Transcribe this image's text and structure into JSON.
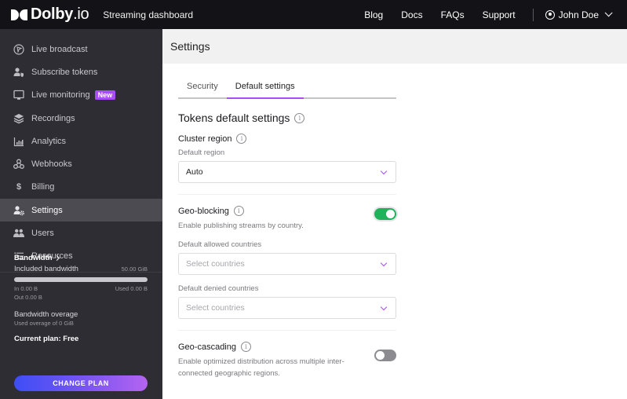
{
  "topbar": {
    "brand": "Dolby",
    "brand_suffix": ".io",
    "product": "Streaming dashboard",
    "links": [
      "Blog",
      "Docs",
      "FAQs",
      "Support"
    ],
    "user_name": "John Doe"
  },
  "sidebar": {
    "items": [
      {
        "label": "Live broadcast",
        "icon": "broadcast-icon"
      },
      {
        "label": "Subscribe tokens",
        "icon": "user-shield-icon"
      },
      {
        "label": "Live monitoring",
        "icon": "monitor-icon",
        "badge": "New"
      },
      {
        "label": "Recordings",
        "icon": "layers-icon"
      },
      {
        "label": "Analytics",
        "icon": "bar-chart-icon"
      },
      {
        "label": "Webhooks",
        "icon": "webhook-icon"
      },
      {
        "label": "Billing",
        "icon": "dollar-icon"
      },
      {
        "label": "Settings",
        "icon": "user-gear-icon",
        "active": true
      },
      {
        "label": "Users",
        "icon": "users-icon"
      },
      {
        "label": "Resources",
        "icon": "list-icon"
      }
    ],
    "bandwidth": {
      "title": "Bandwidth",
      "included_label": "Included bandwidth",
      "included_value": "50.00 GiB",
      "usage_fraction": 0,
      "in_label": "In 0.00 B",
      "used_label": "Used 0.00 B",
      "out_label": "Out 0.00 B",
      "overage_title": "Bandwidth overage",
      "overage_sub": "Used overage of 0 GiB",
      "plan": "Current plan: Free",
      "change_plan": "CHANGE PLAN"
    }
  },
  "page": {
    "title": "Settings",
    "tabs": [
      {
        "label": "Security",
        "active": false
      },
      {
        "label": "Default settings",
        "active": true
      }
    ],
    "section_title": "Tokens default settings",
    "cluster": {
      "title": "Cluster region",
      "sub": "Default region",
      "value": "Auto"
    },
    "geo_blocking": {
      "title": "Geo-blocking",
      "desc": "Enable publishing streams by country.",
      "enabled": true,
      "allowed_label": "Default allowed countries",
      "allowed_placeholder": "Select countries",
      "denied_label": "Default denied countries",
      "denied_placeholder": "Select countries"
    },
    "geo_cascading": {
      "title": "Geo-cascading",
      "desc": "Enable optimized distribution across multiple inter-connected geographic regions.",
      "enabled": false
    }
  },
  "colors": {
    "accent": "#a94ef5",
    "toggle_on": "#1fb25a",
    "topbar_bg": "#131217",
    "sidebar_bg": "#2e2d33"
  }
}
